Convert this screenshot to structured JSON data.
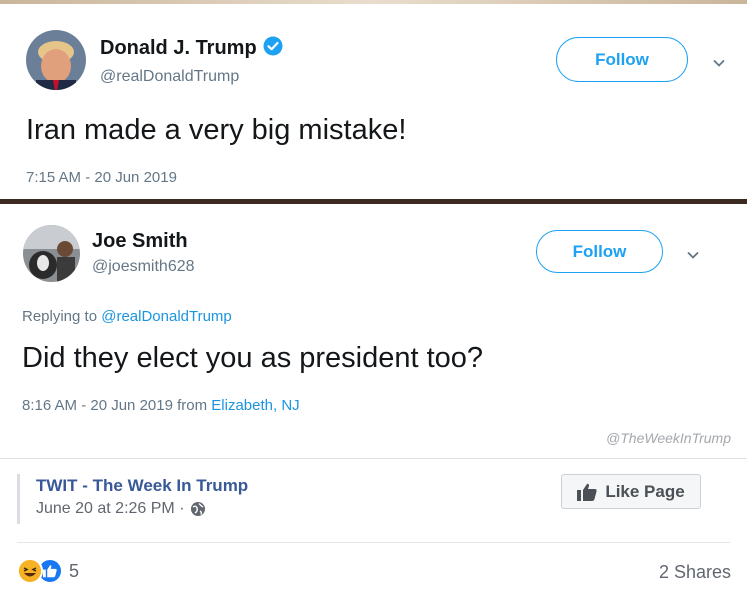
{
  "tweet1": {
    "name": "Donald J. Trump",
    "handle": "@realDonaldTrump",
    "follow_label": "Follow",
    "text": "Iran made a very big mistake!",
    "timestamp": "7:15 AM - 20 Jun 2019"
  },
  "tweet2": {
    "name": "Joe Smith",
    "handle": "@joesmith628",
    "follow_label": "Follow",
    "replying_prefix": "Replying to ",
    "replying_handle": "@realDonaldTrump",
    "text": "Did they elect you as president too?",
    "timestamp": "8:16 AM - 20 Jun 2019 from ",
    "location": "Elizabeth, NJ",
    "watermark": "@TheWeekInTrump"
  },
  "facebook": {
    "page_name": "TWIT - The Week In Trump",
    "post_time": "June 20 at 2:26 PM ·",
    "like_page_label": "Like Page",
    "reaction_count": "5",
    "shares": "2 Shares"
  },
  "colors": {
    "twitter_blue": "#1da1f2",
    "link_blue": "#1b95e0",
    "fb_blue": "#385898",
    "verified": "#1da1f2"
  }
}
